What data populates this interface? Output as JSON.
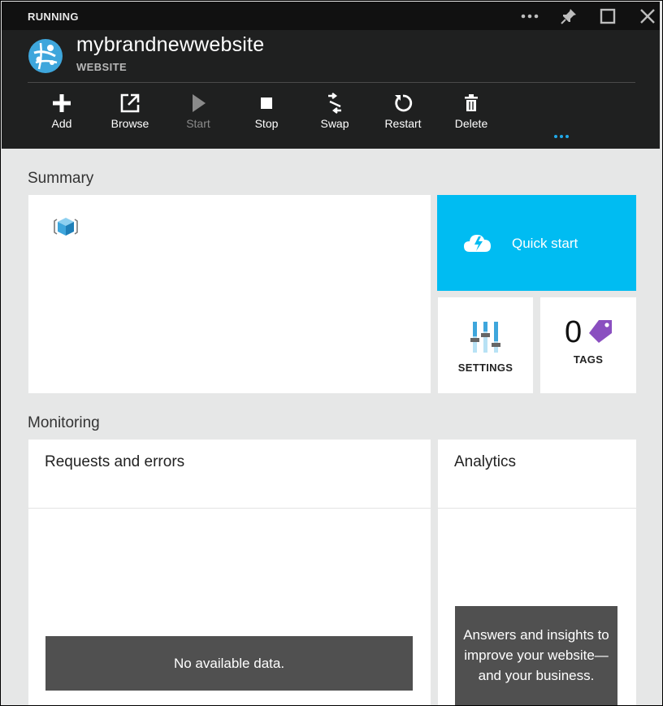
{
  "window": {
    "status": "RUNNING",
    "controls": [
      "more-icon",
      "pin-icon",
      "maximize-icon",
      "close-icon"
    ]
  },
  "site": {
    "name": "mybrandnewwebsite",
    "type": "WEBSITE",
    "icon": "azure-website-icon"
  },
  "commands": [
    {
      "label": "Add",
      "icon": "plus-icon",
      "enabled": true
    },
    {
      "label": "Browse",
      "icon": "external-link-icon",
      "enabled": true
    },
    {
      "label": "Start",
      "icon": "play-icon",
      "enabled": false
    },
    {
      "label": "Stop",
      "icon": "stop-icon",
      "enabled": true
    },
    {
      "label": "Swap",
      "icon": "swap-icon",
      "enabled": true
    },
    {
      "label": "Restart",
      "icon": "restart-icon",
      "enabled": true
    },
    {
      "label": "Delete",
      "icon": "trash-icon",
      "enabled": true
    }
  ],
  "summary": {
    "title": "Summary",
    "quick_start": {
      "label": "Quick start",
      "icon": "cloud-lightning-icon",
      "color": "#00bcf2"
    },
    "settings": {
      "label": "SETTINGS",
      "icon": "sliders-icon"
    },
    "tags": {
      "count": "0",
      "label": "TAGS",
      "icon": "tag-icon",
      "color": "#8a4fc0"
    }
  },
  "monitoring": {
    "title": "Monitoring",
    "requests": {
      "title": "Requests and errors",
      "empty_text": "No available data."
    },
    "analytics": {
      "title": "Analytics",
      "promo_text": "Answers and insights to improve your website—and your business."
    }
  },
  "colors": {
    "header_bg": "#1f2020",
    "accent": "#00bcf2",
    "dots": "#20a8e8"
  }
}
